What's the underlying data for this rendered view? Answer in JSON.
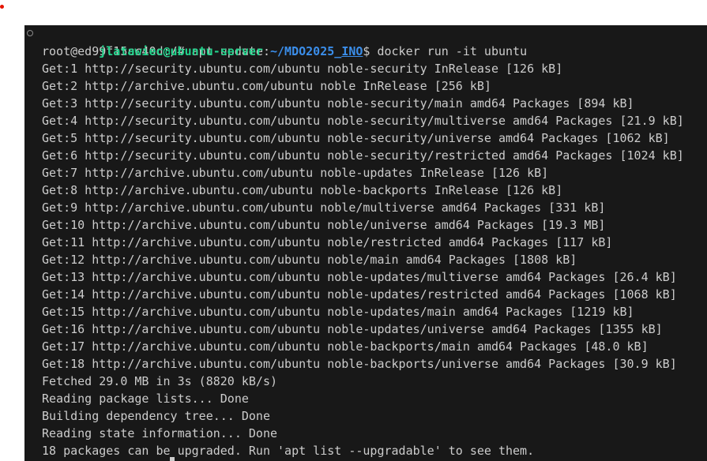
{
  "prompt": {
    "user_host": "jlatawiec@ubuntu-server",
    "colon": ":",
    "path_prefix": "~/MDO2025_",
    "path_underlined": "INO",
    "symbol": "$",
    "command": " docker run -it ubuntu"
  },
  "output_lines": [
    "root@ed99f15cc40d:/# apt update",
    "Get:1 http://security.ubuntu.com/ubuntu noble-security InRelease [126 kB]",
    "Get:2 http://archive.ubuntu.com/ubuntu noble InRelease [256 kB]",
    "Get:3 http://security.ubuntu.com/ubuntu noble-security/main amd64 Packages [894 kB]",
    "Get:4 http://security.ubuntu.com/ubuntu noble-security/multiverse amd64 Packages [21.9 kB]",
    "Get:5 http://security.ubuntu.com/ubuntu noble-security/universe amd64 Packages [1062 kB]",
    "Get:6 http://security.ubuntu.com/ubuntu noble-security/restricted amd64 Packages [1024 kB]",
    "Get:7 http://archive.ubuntu.com/ubuntu noble-updates InRelease [126 kB]",
    "Get:8 http://archive.ubuntu.com/ubuntu noble-backports InRelease [126 kB]",
    "Get:9 http://archive.ubuntu.com/ubuntu noble/multiverse amd64 Packages [331 kB]",
    "Get:10 http://archive.ubuntu.com/ubuntu noble/universe amd64 Packages [19.3 MB]",
    "Get:11 http://archive.ubuntu.com/ubuntu noble/restricted amd64 Packages [117 kB]",
    "Get:12 http://archive.ubuntu.com/ubuntu noble/main amd64 Packages [1808 kB]",
    "Get:13 http://archive.ubuntu.com/ubuntu noble-updates/multiverse amd64 Packages [26.4 kB]",
    "Get:14 http://archive.ubuntu.com/ubuntu noble-updates/restricted amd64 Packages [1068 kB]",
    "Get:15 http://archive.ubuntu.com/ubuntu noble-updates/main amd64 Packages [1219 kB]",
    "Get:16 http://archive.ubuntu.com/ubuntu noble-updates/universe amd64 Packages [1355 kB]",
    "Get:17 http://archive.ubuntu.com/ubuntu noble-backports/main amd64 Packages [48.0 kB]",
    "Get:18 http://archive.ubuntu.com/ubuntu noble-backports/universe amd64 Packages [30.9 kB]",
    "Fetched 29.0 MB in 3s (8820 kB/s)",
    "Reading package lists... Done",
    "Building dependency tree... Done",
    "Reading state information... Done",
    "18 packages can be upgraded. Run 'apt list --upgradable' to see them."
  ],
  "colors": {
    "terminal_bg": "#181818",
    "text": "#cccccc",
    "prompt_user": "#23d18b",
    "prompt_path": "#3b8eea"
  },
  "icons": {
    "command_decoration": "circle-outline-icon"
  }
}
